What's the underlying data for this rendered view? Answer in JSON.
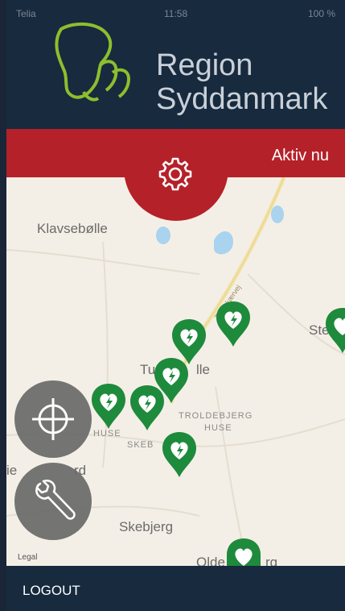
{
  "app": {
    "brand_line1": "Region",
    "brand_line2": "Syddanmark"
  },
  "status_bar": {
    "carrier": "Telia",
    "time": "11:58",
    "battery": "100 %"
  },
  "toolbar": {
    "status_label": "Aktiv nu",
    "settings_icon": "gear-icon"
  },
  "map": {
    "places": [
      "Klavsebølle",
      "Tu",
      "lle",
      "TROLDEBJERG",
      "HUSE",
      "HUSE",
      "SKEB",
      "Skebjerg",
      "Ste",
      "Olde",
      "rg",
      "ie",
      "rd",
      "Legal"
    ],
    "road_label": "Tranekærvej",
    "marker_icon": "aed-defibrillator-icon"
  },
  "fabs": {
    "locate_icon": "crosshair-icon",
    "tools_icon": "wrench-icon"
  },
  "footer": {
    "logout_label": "LOGOUT"
  },
  "colors": {
    "header": "#172a3e",
    "accent_red": "#b52129",
    "marker_green": "#1e8a3c",
    "map_bg": "#f4efe6"
  }
}
